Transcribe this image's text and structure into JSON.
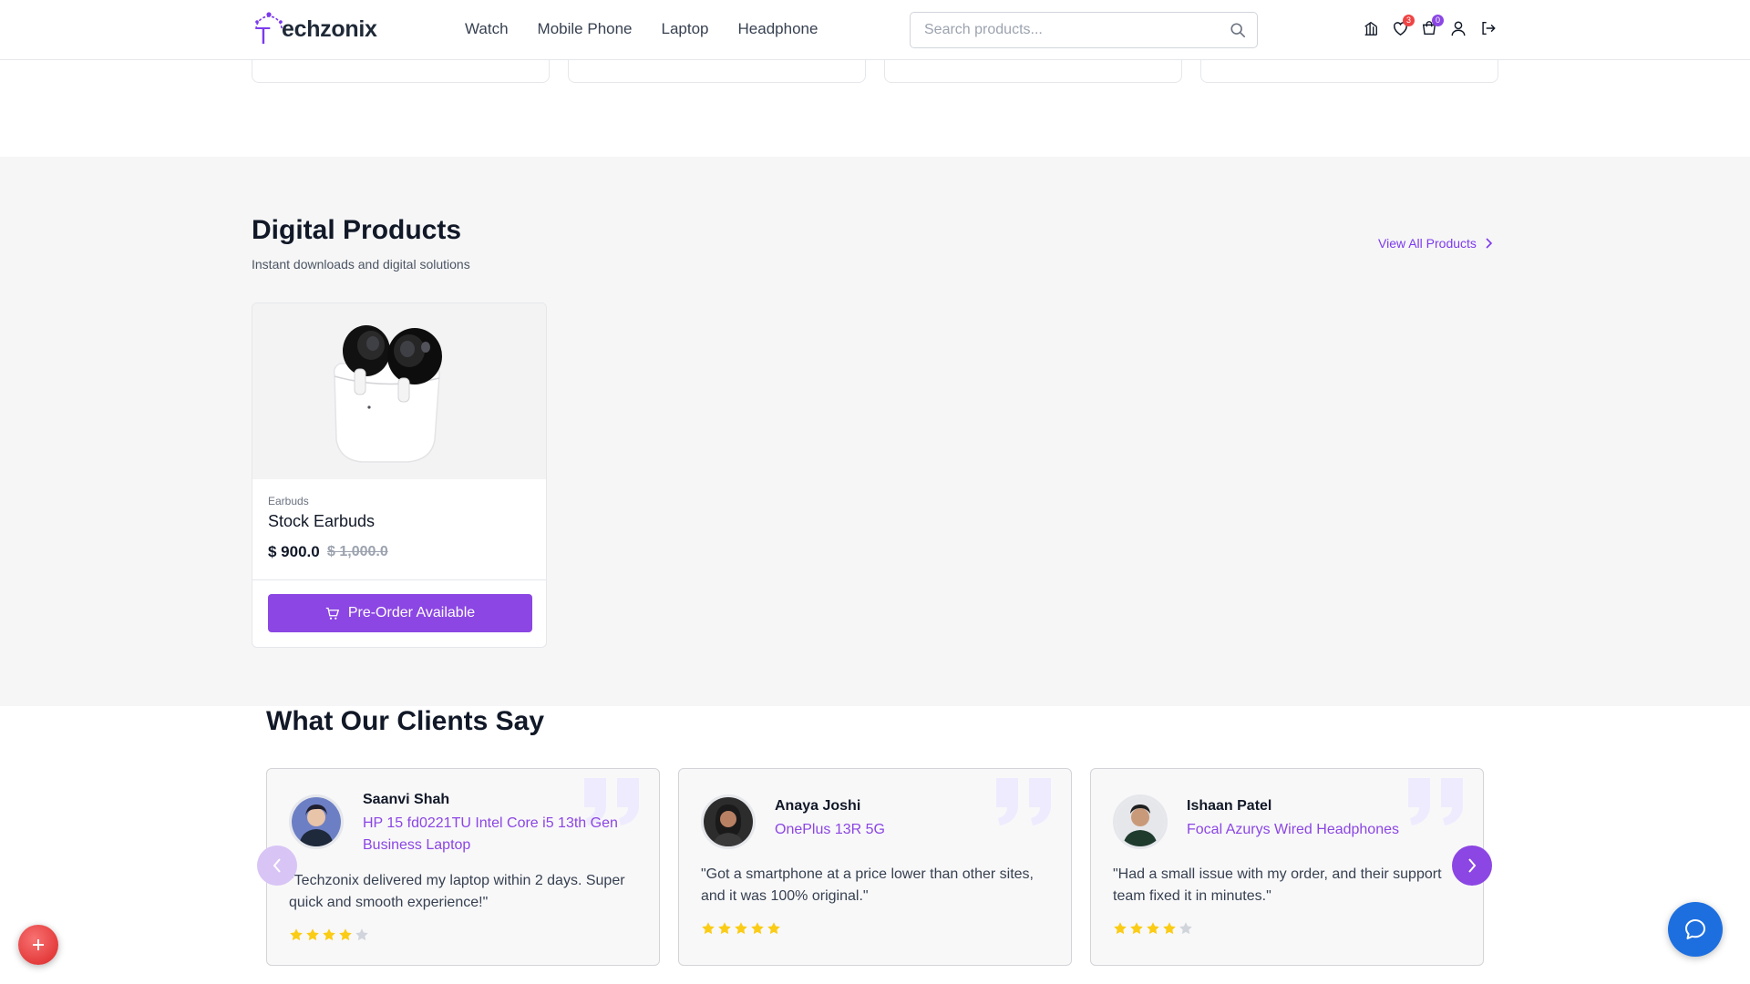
{
  "header": {
    "logo_text": "Techzonix",
    "logo_first_letter": "T",
    "logo_rest": "echzonix",
    "nav": [
      "Watch",
      "Mobile Phone",
      "Laptop",
      "Headphone"
    ],
    "search_placeholder": "Search products...",
    "wishlist_count": "3",
    "cart_count": "0",
    "icons": [
      "compare-icon",
      "heart-icon",
      "cart-icon",
      "user-icon",
      "logout-icon"
    ]
  },
  "digital": {
    "title": "Digital Products",
    "subtitle": "Instant downloads and digital solutions",
    "view_all": "View All Products",
    "products": [
      {
        "category": "Earbuds",
        "name": "Stock Earbuds",
        "price": "$ 900.0",
        "old_price": "$ 1,000.0",
        "button": "Pre-Order Available"
      }
    ]
  },
  "testimonials": {
    "title": "What Our Clients Say",
    "items": [
      {
        "name": "Saanvi Shah",
        "product": "HP 15 fd0221TU Intel Core i5 13th Gen Business Laptop",
        "quote": "\"Techzonix delivered my laptop within 2 days. Super quick and smooth experience!\"",
        "rating": 4
      },
      {
        "name": "Anaya Joshi",
        "product": "OnePlus 13R 5G",
        "quote": "\"Got a smartphone at a price lower than other sites, and it was 100% original.\"",
        "rating": 5
      },
      {
        "name": "Ishaan Patel",
        "product": "Focal Azurys Wired Headphones",
        "quote": "\"Had a small issue with my order, and their support team fixed it in minutes.\"",
        "rating": 4
      }
    ]
  },
  "colors": {
    "accent": "#8b46e3",
    "star": "#facc15",
    "star_empty": "#d1d5db",
    "chat": "#1d6fe0",
    "fab": "#dc2626"
  }
}
